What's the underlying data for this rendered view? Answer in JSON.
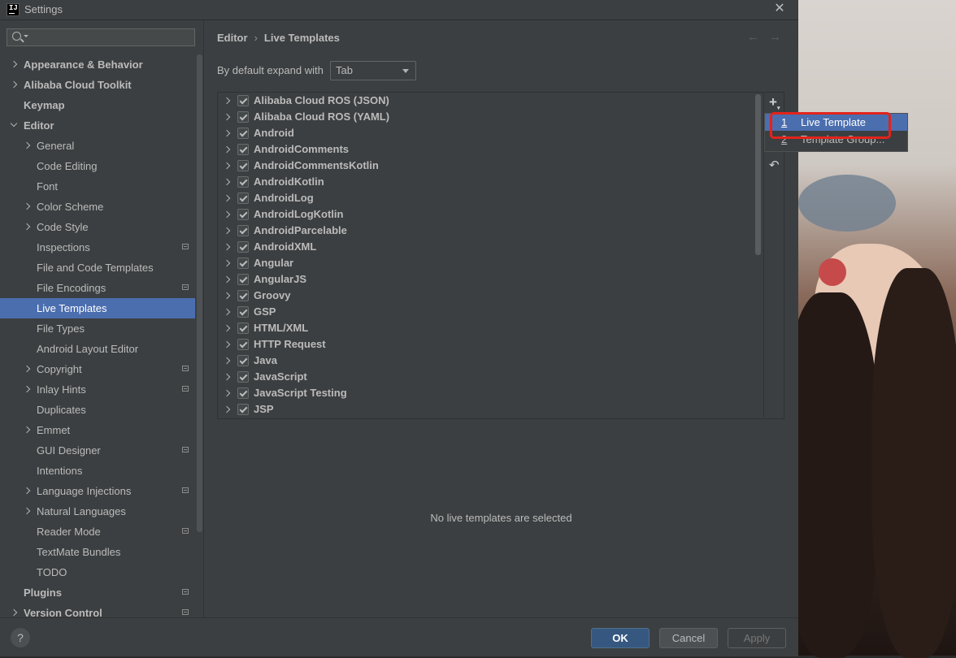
{
  "window": {
    "title": "Settings",
    "app_icon_text": "IJ"
  },
  "search": {
    "placeholder": ""
  },
  "sidebar": {
    "items": [
      {
        "label": "Appearance & Behavior",
        "level": 0,
        "bold": true,
        "chevron": "right",
        "project": false,
        "selected": false
      },
      {
        "label": "Alibaba Cloud Toolkit",
        "level": 0,
        "bold": true,
        "chevron": "right",
        "project": false,
        "selected": false
      },
      {
        "label": "Keymap",
        "level": 0,
        "bold": true,
        "chevron": "none",
        "project": false,
        "selected": false
      },
      {
        "label": "Editor",
        "level": 0,
        "bold": true,
        "chevron": "down",
        "project": false,
        "selected": false
      },
      {
        "label": "General",
        "level": 1,
        "bold": false,
        "chevron": "right",
        "project": false,
        "selected": false
      },
      {
        "label": "Code Editing",
        "level": 1,
        "bold": false,
        "chevron": "none",
        "project": false,
        "selected": false
      },
      {
        "label": "Font",
        "level": 1,
        "bold": false,
        "chevron": "none",
        "project": false,
        "selected": false
      },
      {
        "label": "Color Scheme",
        "level": 1,
        "bold": false,
        "chevron": "right",
        "project": false,
        "selected": false
      },
      {
        "label": "Code Style",
        "level": 1,
        "bold": false,
        "chevron": "right",
        "project": false,
        "selected": false
      },
      {
        "label": "Inspections",
        "level": 1,
        "bold": false,
        "chevron": "none",
        "project": true,
        "selected": false
      },
      {
        "label": "File and Code Templates",
        "level": 1,
        "bold": false,
        "chevron": "none",
        "project": false,
        "selected": false
      },
      {
        "label": "File Encodings",
        "level": 1,
        "bold": false,
        "chevron": "none",
        "project": true,
        "selected": false
      },
      {
        "label": "Live Templates",
        "level": 1,
        "bold": false,
        "chevron": "none",
        "project": false,
        "selected": true
      },
      {
        "label": "File Types",
        "level": 1,
        "bold": false,
        "chevron": "none",
        "project": false,
        "selected": false
      },
      {
        "label": "Android Layout Editor",
        "level": 1,
        "bold": false,
        "chevron": "none",
        "project": false,
        "selected": false
      },
      {
        "label": "Copyright",
        "level": 1,
        "bold": false,
        "chevron": "right",
        "project": true,
        "selected": false
      },
      {
        "label": "Inlay Hints",
        "level": 1,
        "bold": false,
        "chevron": "right",
        "project": true,
        "selected": false
      },
      {
        "label": "Duplicates",
        "level": 1,
        "bold": false,
        "chevron": "none",
        "project": false,
        "selected": false
      },
      {
        "label": "Emmet",
        "level": 1,
        "bold": false,
        "chevron": "right",
        "project": false,
        "selected": false
      },
      {
        "label": "GUI Designer",
        "level": 1,
        "bold": false,
        "chevron": "none",
        "project": true,
        "selected": false
      },
      {
        "label": "Intentions",
        "level": 1,
        "bold": false,
        "chevron": "none",
        "project": false,
        "selected": false
      },
      {
        "label": "Language Injections",
        "level": 1,
        "bold": false,
        "chevron": "right",
        "project": true,
        "selected": false
      },
      {
        "label": "Natural Languages",
        "level": 1,
        "bold": false,
        "chevron": "right",
        "project": false,
        "selected": false
      },
      {
        "label": "Reader Mode",
        "level": 1,
        "bold": false,
        "chevron": "none",
        "project": true,
        "selected": false
      },
      {
        "label": "TextMate Bundles",
        "level": 1,
        "bold": false,
        "chevron": "none",
        "project": false,
        "selected": false
      },
      {
        "label": "TODO",
        "level": 1,
        "bold": false,
        "chevron": "none",
        "project": false,
        "selected": false
      },
      {
        "label": "Plugins",
        "level": 0,
        "bold": true,
        "chevron": "none",
        "project": true,
        "selected": false
      },
      {
        "label": "Version Control",
        "level": 0,
        "bold": true,
        "chevron": "right",
        "project": true,
        "selected": false
      }
    ]
  },
  "breadcrumb": {
    "parent": "Editor",
    "separator": "›",
    "current": "Live Templates"
  },
  "nav": {
    "back": "←",
    "forward": "→"
  },
  "expand": {
    "label": "By default expand with",
    "value": "Tab"
  },
  "template_groups": [
    "Alibaba Cloud ROS (JSON)",
    "Alibaba Cloud ROS (YAML)",
    "Android",
    "AndroidComments",
    "AndroidCommentsKotlin",
    "AndroidKotlin",
    "AndroidLog",
    "AndroidLogKotlin",
    "AndroidParcelable",
    "AndroidXML",
    "Angular",
    "AngularJS",
    "Groovy",
    "GSP",
    "HTML/XML",
    "HTTP Request",
    "Java",
    "JavaScript",
    "JavaScript Testing",
    "JSP"
  ],
  "tools": {
    "add": "+",
    "undo": "↶"
  },
  "popup": {
    "items": [
      {
        "mnemonic": "1",
        "label": "Live Template",
        "selected": true
      },
      {
        "mnemonic": "2",
        "label": "Template Group...",
        "selected": false
      }
    ]
  },
  "empty_message": "No live templates are selected",
  "buttons": {
    "help": "?",
    "ok": "OK",
    "cancel": "Cancel",
    "apply": "Apply"
  },
  "colors": {
    "selection": "#4b6eaf",
    "highlight_box": "#e3231b",
    "ok_button": "#365880"
  }
}
